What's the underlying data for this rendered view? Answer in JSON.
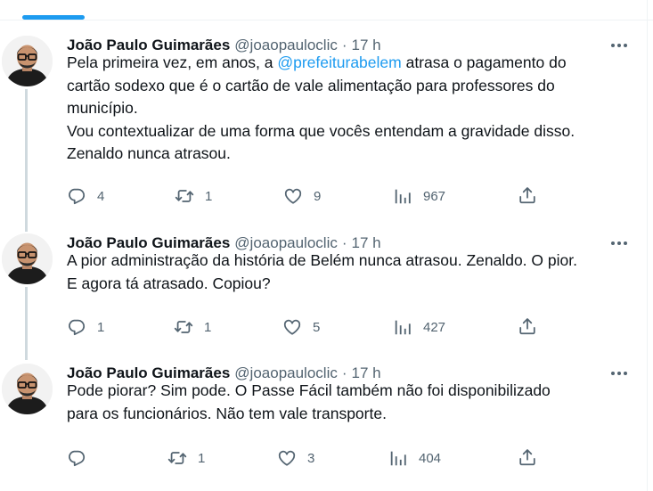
{
  "colors": {
    "accent": "#1d9bf0",
    "text": "#0f1419",
    "muted": "#536471",
    "border": "#eff3f4"
  },
  "tweets": [
    {
      "author": {
        "name": "João Paulo Guimarães",
        "handle": "@joaopauloclic"
      },
      "separator": "·",
      "time": "17 h",
      "lines": [
        {
          "before": "Pela primeira vez, em anos, a ",
          "mention": "@prefeiturabelem",
          "after": " atrasa o pagamento do"
        },
        {
          "text": "cartão sodexo que é o cartão de vale alimentação para professores do"
        },
        {
          "text": "município."
        },
        {
          "text": "Vou contextualizar de uma forma que vocês entendam a gravidade disso."
        },
        {
          "text": "Zenaldo nunca atrasou."
        }
      ],
      "stats": {
        "replies": "4",
        "retweets": "1",
        "likes": "9",
        "views": "967"
      }
    },
    {
      "author": {
        "name": "João Paulo Guimarães",
        "handle": "@joaopauloclic"
      },
      "separator": "·",
      "time": "17 h",
      "lines": [
        {
          "text": "A pior administração da história de Belém nunca atrasou. Zenaldo. O pior."
        },
        {
          "text": "E agora tá atrasado. Copiou?"
        }
      ],
      "stats": {
        "replies": "1",
        "retweets": "1",
        "likes": "5",
        "views": "427"
      }
    },
    {
      "author": {
        "name": "João Paulo Guimarães",
        "handle": "@joaopauloclic"
      },
      "separator": "·",
      "time": "17 h",
      "lines": [
        {
          "text": "Pode piorar? Sim pode. O Passe Fácil também não foi disponibilizado"
        },
        {
          "text": "para os funcionários. Não tem vale transporte."
        }
      ],
      "stats": {
        "replies": "",
        "retweets": "1",
        "likes": "3",
        "views": "404"
      }
    }
  ],
  "icons": {
    "reply": "reply-icon",
    "retweet": "retweet-icon",
    "like": "heart-icon",
    "views": "views-icon",
    "share": "share-icon",
    "more": "more-icon"
  }
}
